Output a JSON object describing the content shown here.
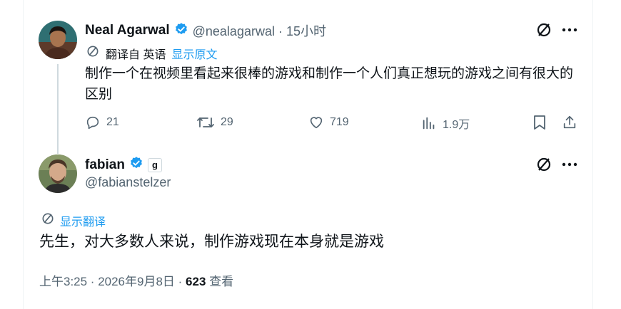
{
  "tweet1": {
    "author_name": "Neal Agarwal",
    "handle_time": "@nealagarwal · 15小时",
    "translated_from": "翻译自 英语",
    "show_original": "显示原文",
    "text": "制作一个在视频里看起来很棒的游戏和制作一个人们真正想玩的游戏之间有很大的区别",
    "replies": "21",
    "retweets": "29",
    "likes": "719",
    "views": "1.9万"
  },
  "tweet2": {
    "author_name": "fabian",
    "affiliate_badge": "g",
    "handle": "@fabianstelzer",
    "show_translation": "显示翻译",
    "text": "先生，对大多数人来说，制作游戏现在本身就是游戏",
    "timestamp": "上午3:25 · 2026年9月8日 · ",
    "views_count": "623",
    "views_label": " 查看"
  },
  "colors": {
    "verified_blue": "#1d9bf0",
    "text_primary": "#0f1419",
    "text_secondary": "#536471",
    "thread_line": "#cfd9de"
  },
  "icons": [
    "grok-slash-icon",
    "more-icon",
    "translate-icon",
    "reply-icon",
    "retweet-icon",
    "like-icon",
    "views-icon",
    "bookmark-icon",
    "share-icon",
    "verified-icon"
  ]
}
